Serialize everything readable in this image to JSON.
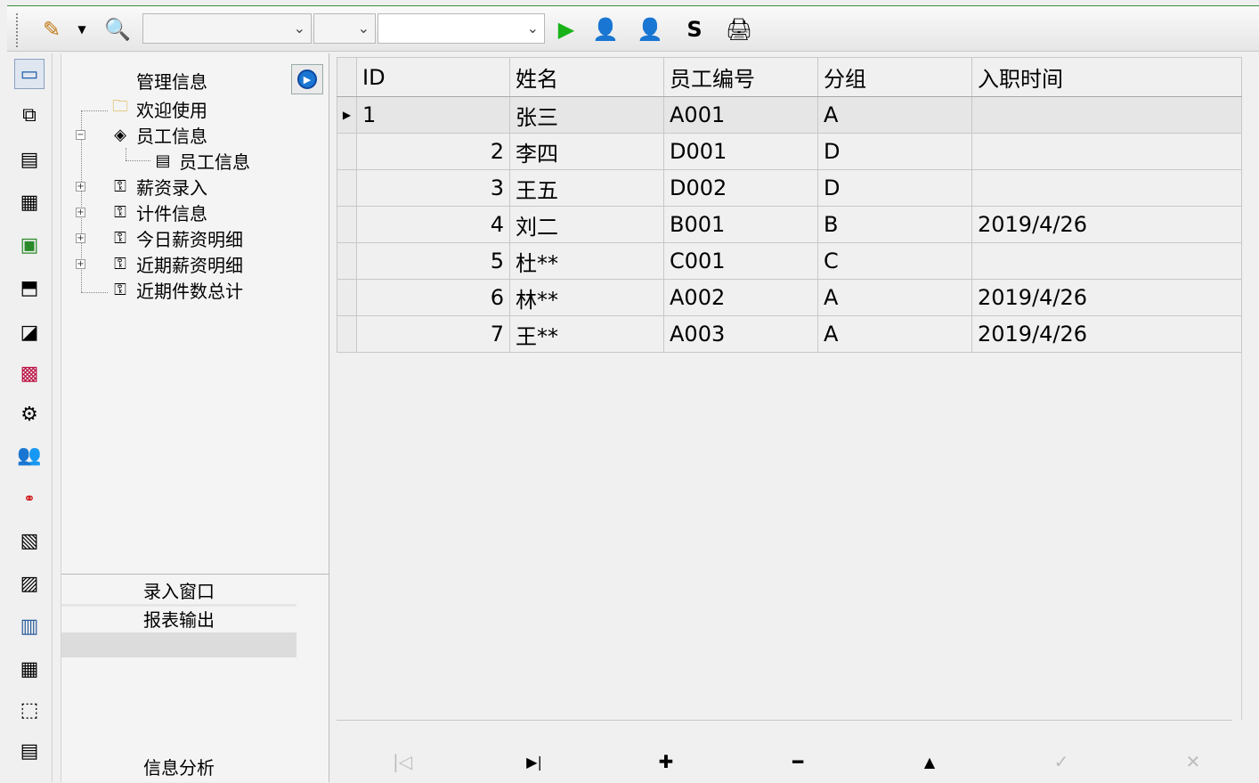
{
  "toolbar": {
    "icons": [
      "pencil-icon",
      "dropdown-arrow-icon",
      "search-doc-icon",
      "run-icon",
      "find-person-icon",
      "find-person-2-icon",
      "swap-icon",
      "printer-icon"
    ],
    "combo1_value": "",
    "combo2_value": "",
    "combo3_value": ""
  },
  "iconbar": {
    "icons": [
      "window-icon",
      "hierarchy-icon",
      "grid-icon",
      "document-icon",
      "chart-icon",
      "print-form-icon",
      "table-icon",
      "copy-icon",
      "settings-icon",
      "users-icon",
      "links-icon",
      "report-icon",
      "export-icon",
      "calendar-icon",
      "keypad-icon",
      "analysis-icon",
      "notes-icon"
    ]
  },
  "nav": {
    "title": "管理信息",
    "tree": [
      {
        "label": "欢迎使用",
        "icon": "folder-icon"
      },
      {
        "label": "员工信息",
        "icon": "tag-icon"
      },
      {
        "label": "员工信息",
        "icon": "form-icon"
      },
      {
        "label": "薪资录入",
        "icon": "key-icon"
      },
      {
        "label": "计件信息",
        "icon": "key-icon"
      },
      {
        "label": "今日薪资明细",
        "icon": "key-icon"
      },
      {
        "label": "近期薪资明细",
        "icon": "key-icon"
      },
      {
        "label": "近期件数总计",
        "icon": "key-icon"
      }
    ],
    "sections": [
      "录入窗口",
      "报表输出",
      "信息分析"
    ]
  },
  "grid": {
    "columns": [
      "ID",
      "姓名",
      "员工编号",
      "分组",
      "入职时间"
    ],
    "rows": [
      {
        "id": "1",
        "name": "张三",
        "code": "A001",
        "group": "A",
        "date": ""
      },
      {
        "id": "2",
        "name": "李四",
        "code": "D001",
        "group": "D",
        "date": ""
      },
      {
        "id": "3",
        "name": "王五",
        "code": "D002",
        "group": "D",
        "date": ""
      },
      {
        "id": "4",
        "name": "刘二",
        "code": "B001",
        "group": "B",
        "date": "2019/4/26"
      },
      {
        "id": "5",
        "name": "杜**",
        "code": "C001",
        "group": "C",
        "date": ""
      },
      {
        "id": "6",
        "name": "林**",
        "code": "A002",
        "group": "A",
        "date": "2019/4/26"
      },
      {
        "id": "7",
        "name": "王**",
        "code": "A003",
        "group": "A",
        "date": "2019/4/26"
      }
    ],
    "row_indicator": "▶"
  },
  "navigator": {
    "buttons": [
      {
        "name": "first-record",
        "glyph": "|◁",
        "enabled": false
      },
      {
        "name": "last-record",
        "glyph": "▶|",
        "enabled": true
      },
      {
        "name": "insert-record",
        "glyph": "✚",
        "enabled": true
      },
      {
        "name": "delete-record",
        "glyph": "━",
        "enabled": true
      },
      {
        "name": "edit-record",
        "glyph": "▲",
        "enabled": true
      },
      {
        "name": "post-record",
        "glyph": "✓",
        "enabled": false
      },
      {
        "name": "cancel-record",
        "glyph": "✕",
        "enabled": false
      }
    ]
  }
}
